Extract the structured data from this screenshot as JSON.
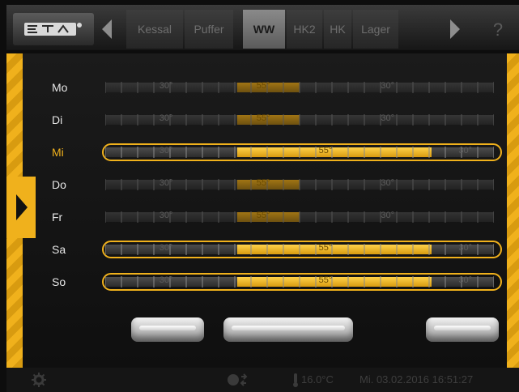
{
  "nav": {
    "tabs": [
      {
        "label": "Kessal",
        "active": false
      },
      {
        "label": "Puffer",
        "active": false
      },
      {
        "label": "WW",
        "active": true
      },
      {
        "label": "HK2",
        "active": false
      },
      {
        "label": "HK",
        "active": false
      },
      {
        "label": "Lager",
        "active": false
      }
    ],
    "help_label": "?"
  },
  "days": [
    {
      "label": "Mo",
      "selected": false,
      "outlined": false,
      "fill_range": [
        0.34,
        0.5
      ],
      "labels": [
        "30°",
        "55°",
        "30°"
      ]
    },
    {
      "label": "Di",
      "selected": false,
      "outlined": false,
      "fill_range": [
        0.34,
        0.5
      ],
      "labels": [
        "30°",
        "55°",
        "30°"
      ]
    },
    {
      "label": "Mi",
      "selected": true,
      "outlined": true,
      "fill_range": [
        0.34,
        0.84
      ],
      "labels": [
        "30°",
        "55°",
        "30°"
      ]
    },
    {
      "label": "Do",
      "selected": false,
      "outlined": false,
      "fill_range": [
        0.34,
        0.5
      ],
      "labels": [
        "30°",
        "55°",
        "30°"
      ]
    },
    {
      "label": "Fr",
      "selected": false,
      "outlined": false,
      "fill_range": [
        0.34,
        0.5
      ],
      "labels": [
        "30°",
        "55°",
        "30°"
      ]
    },
    {
      "label": "Sa",
      "selected": false,
      "outlined": true,
      "fill_range": [
        0.34,
        0.84
      ],
      "labels": [
        "30°",
        "55°",
        "30°"
      ]
    },
    {
      "label": "So",
      "selected": false,
      "outlined": true,
      "fill_range": [
        0.34,
        0.84
      ],
      "labels": [
        "30°",
        "55°",
        "30°"
      ]
    }
  ],
  "status": {
    "temperature": "16.0°C",
    "datetime": "Mi. 03.02.2016 16:51:27"
  },
  "colors": {
    "accent": "#f0b11c",
    "background": "#0d0d0d"
  }
}
